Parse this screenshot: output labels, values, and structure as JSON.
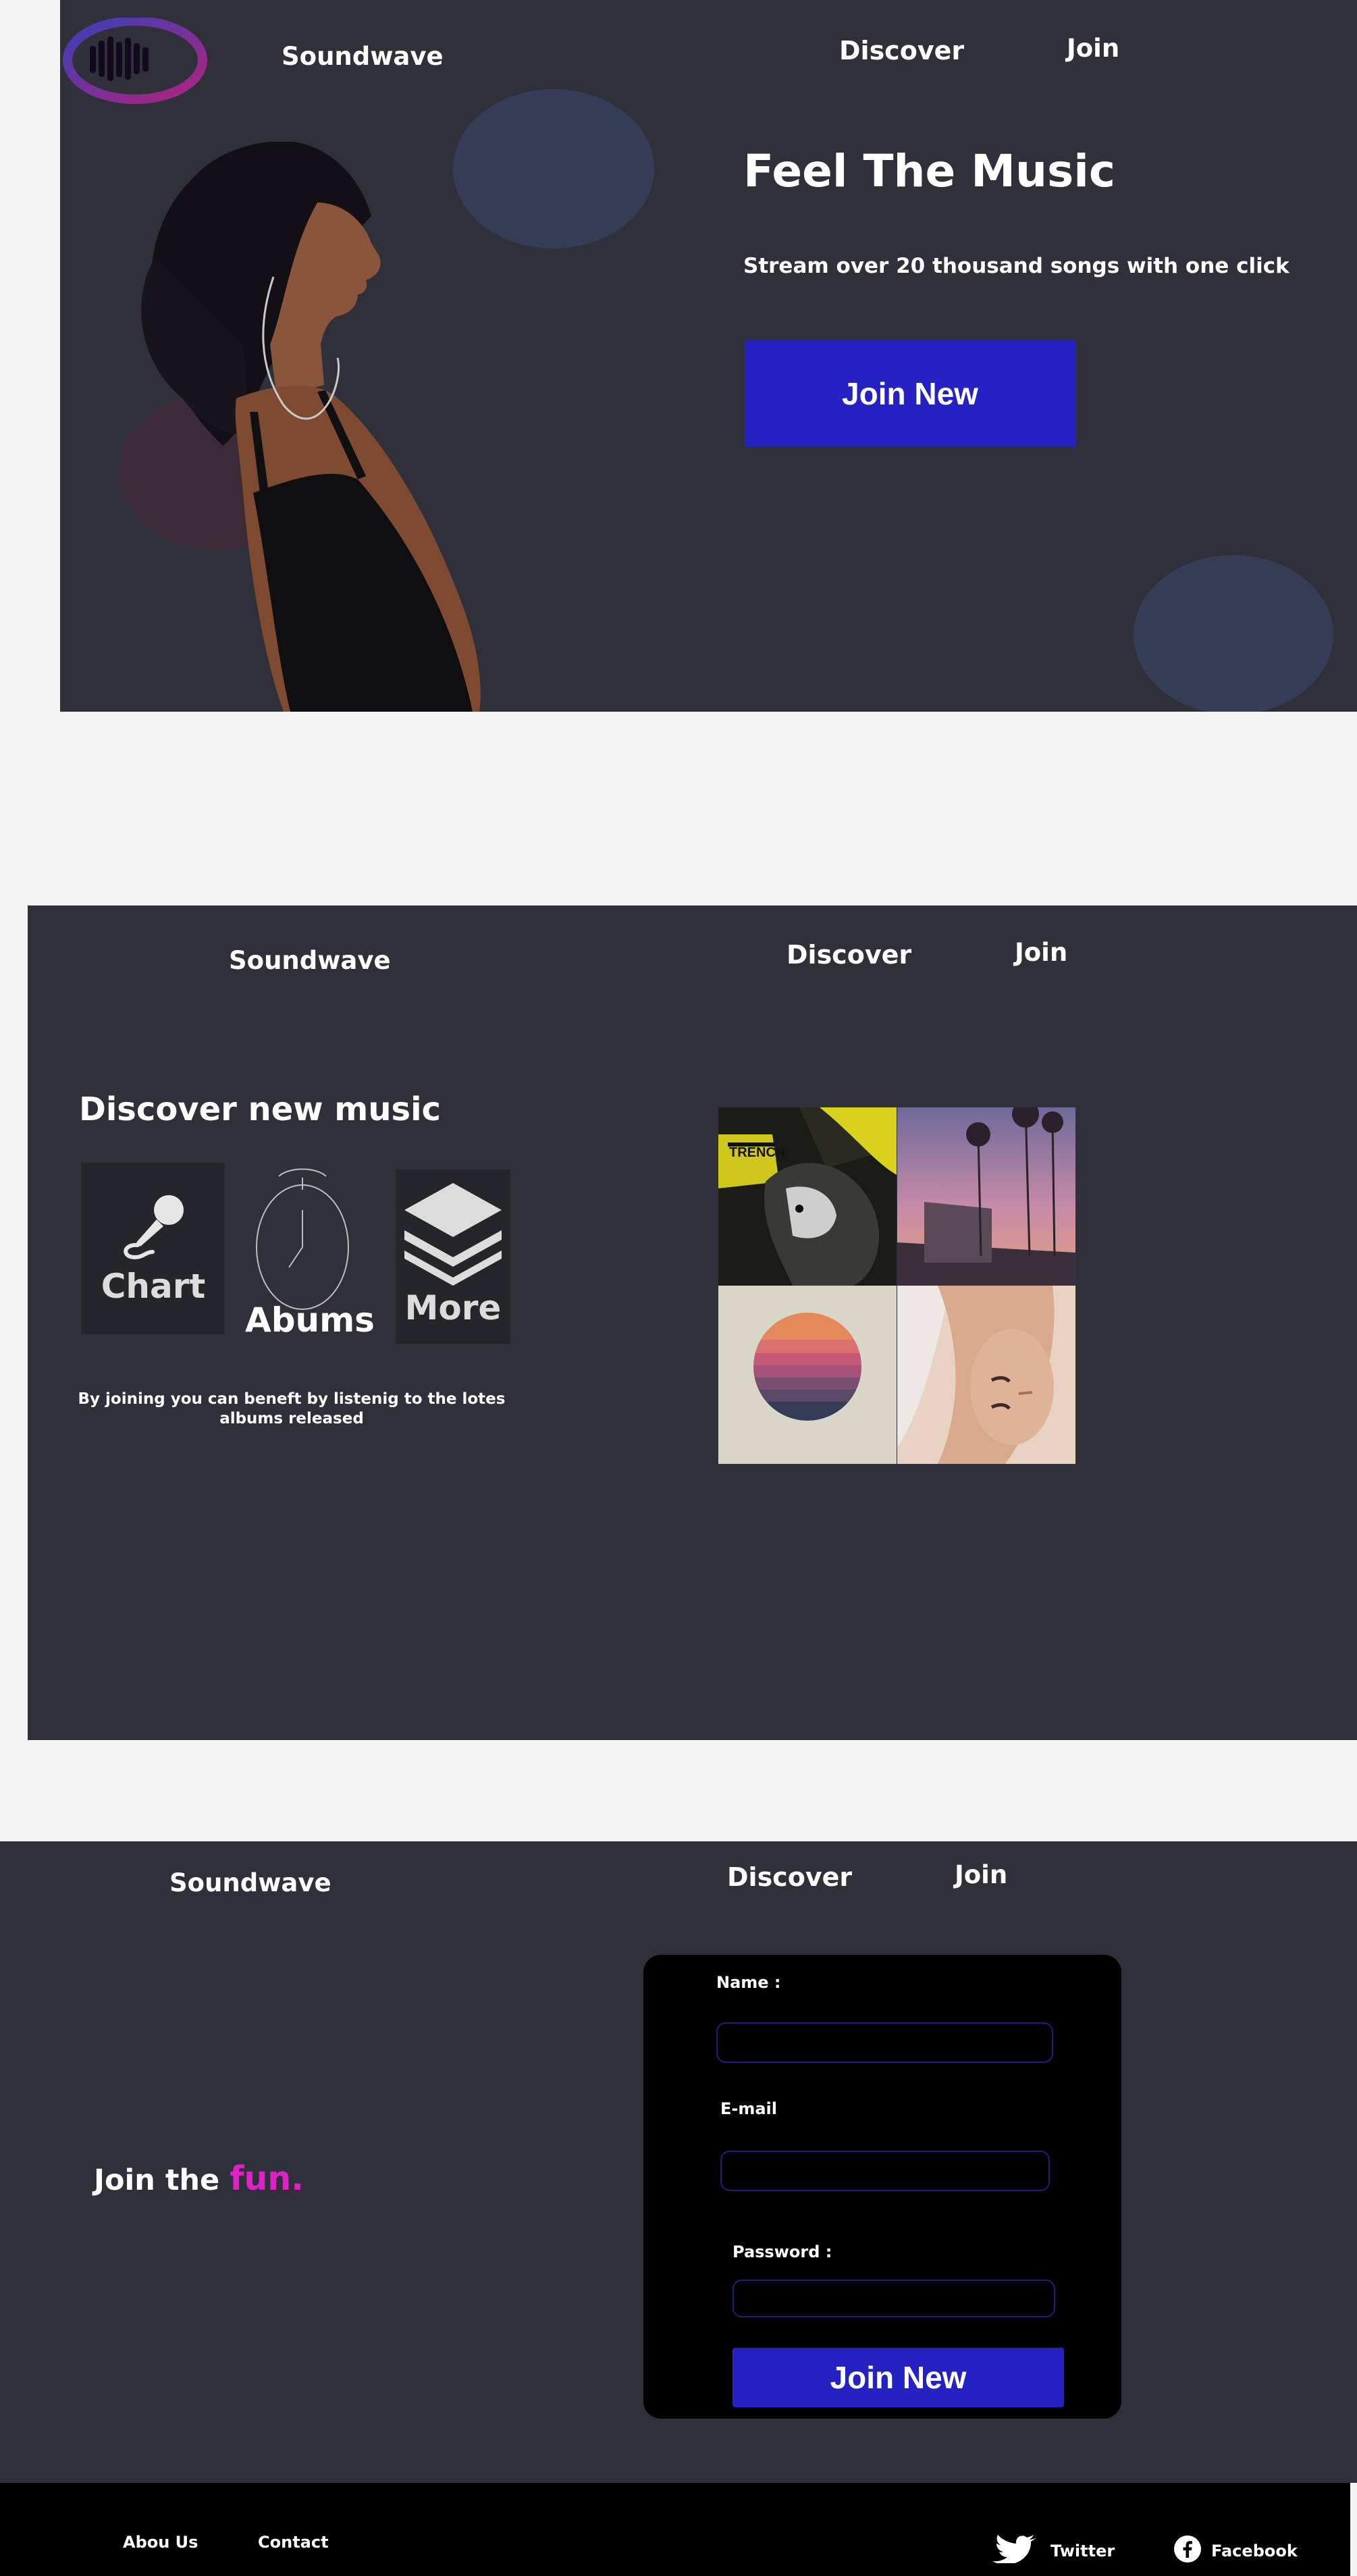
{
  "brand": {
    "name": "Soundwave"
  },
  "nav": {
    "discover": "Discover",
    "join": "Join"
  },
  "hero": {
    "title": "Feel The Music",
    "subtitle": "Stream over 20 thousand songs with one click",
    "cta": "Join New"
  },
  "discover": {
    "title": "Discover new music",
    "features": [
      {
        "label": "Chart",
        "icon": "microphone-icon"
      },
      {
        "label": "Abums",
        "icon": "clock-icon"
      },
      {
        "label": "More",
        "icon": "layers-icon"
      }
    ],
    "description": "By joining you can beneft by listenig to the lotes albums released",
    "album_cover_texts": {
      "trench": "TRENCH"
    }
  },
  "join": {
    "headline_prefix": "Join the",
    "headline_highlight": "fun.",
    "form": {
      "name_label": "Name :",
      "email_label": "E-mail",
      "password_label": "Password :",
      "name_value": "",
      "email_value": "",
      "password_value": "",
      "submit": "Join New"
    }
  },
  "footer": {
    "links": [
      "Abou Us",
      "Contact"
    ],
    "social": [
      {
        "label": "Twitter",
        "icon": "twitter-icon"
      },
      {
        "label": "Facebook",
        "icon": "facebook-icon"
      }
    ]
  },
  "colors": {
    "panel": "#30303a",
    "accent": "#2522c4",
    "highlight": "#e021c8",
    "page_bg": "#f4f4f4"
  }
}
